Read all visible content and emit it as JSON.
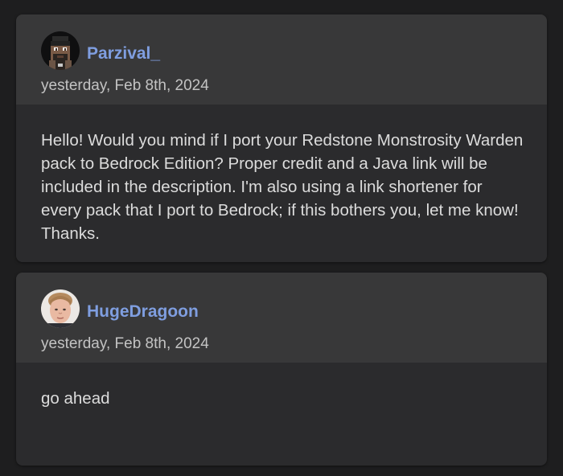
{
  "comments": [
    {
      "username": "Parzival_",
      "timestamp": "yesterday, Feb 8th, 2024",
      "avatar_icon": "pixel-character-avatar",
      "text": "Hello! Would you mind if I port your Redstone Monstrosity Warden pack to Bedrock Edition? Proper credit and a Java link will be included in the description. I'm also using a link shortener for every pack that I port to Bedrock; if this bothers you, let me know! Thanks."
    },
    {
      "username": "HugeDragoon",
      "timestamp": "yesterday, Feb 8th, 2024",
      "avatar_icon": "profile-photo-avatar",
      "text": "go ahead"
    }
  ],
  "colors": {
    "background": "#1e1e1f",
    "card": "#2b2b2d",
    "card_header": "#383839",
    "username": "#7f9ee0",
    "text": "#dcdcdc",
    "timestamp": "#c3c3c3"
  }
}
